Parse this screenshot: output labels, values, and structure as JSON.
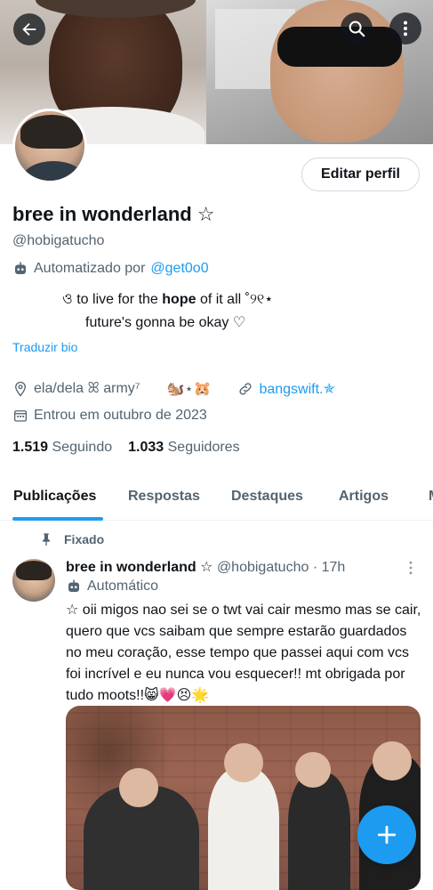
{
  "header": {
    "back_icon": "arrow-left-icon",
    "search_icon": "search-icon",
    "more_icon": "more-vertical-icon"
  },
  "profile": {
    "edit_label": "Editar perfil",
    "name": "bree in wonderland ☆",
    "handle": "@hobigatucho",
    "automated_by_label": "Automatizado por",
    "automated_by_handle": "@get0o0",
    "bio_line1_pre": "ও to live for the ",
    "bio_line1_bold": "hope",
    "bio_line1_post": " of it all ˚୨୧⋆",
    "bio_line2": "future's gonna be okay ♡",
    "translate_label": "Traduzir bio",
    "pronouns_army": "ela/dela ꕤ army⁷",
    "emojis": "🐿️⋆🐹",
    "link": "bangswift.✯",
    "joined": "Entrou em outubro de 2023",
    "following_count": "1.519",
    "following_label": "Seguindo",
    "followers_count": "1.033",
    "followers_label": "Seguidores"
  },
  "tabs": [
    {
      "label": "Publicações"
    },
    {
      "label": "Respostas"
    },
    {
      "label": "Destaques"
    },
    {
      "label": "Artigos"
    },
    {
      "label": "M"
    }
  ],
  "post": {
    "pinned_label": "Fixado",
    "author_name": "bree in wonderland ☆",
    "author_meta": "@hobigatucho · 17h",
    "automated_label": "Automático",
    "text": "☆ oii migos nao sei se o twt vai cair mesmo mas se cair, quero que vcs saibam que sempre estarão guardados no meu coração, esse tempo que passei aqui com vcs foi incrível e eu nunca vou esquecer!! mt obrigada por tudo moots!!😸💗😣🌟"
  },
  "colors": {
    "accent": "#1d9bf0",
    "text": "#0f1419",
    "muted": "#536471"
  }
}
